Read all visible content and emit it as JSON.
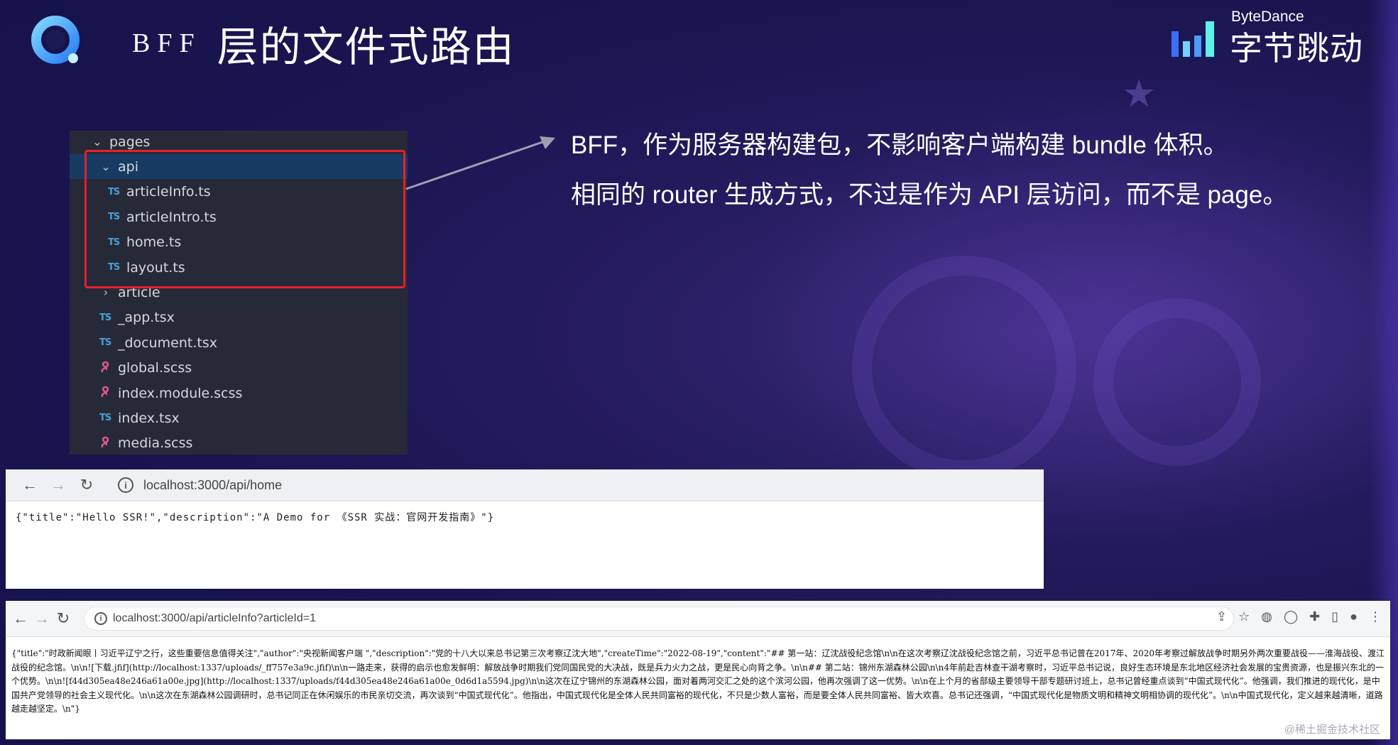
{
  "header": {
    "title_latin": "BFF",
    "title_cjk": "层的文件式路由",
    "brand_small": "ByteDance",
    "brand_main": "字节跳动"
  },
  "file_tree": {
    "rows": [
      {
        "label": "pages",
        "kind": "folder-open"
      },
      {
        "label": "api",
        "kind": "folder-open"
      },
      {
        "label": "articleInfo.ts",
        "kind": "ts"
      },
      {
        "label": "articleIntro.ts",
        "kind": "ts"
      },
      {
        "label": "home.ts",
        "kind": "ts"
      },
      {
        "label": "layout.ts",
        "kind": "ts"
      },
      {
        "label": "article",
        "kind": "folder-closed"
      },
      {
        "label": "_app.tsx",
        "kind": "ts"
      },
      {
        "label": "_document.tsx",
        "kind": "ts"
      },
      {
        "label": "global.scss",
        "kind": "scss"
      },
      {
        "label": "index.module.scss",
        "kind": "scss"
      },
      {
        "label": "index.tsx",
        "kind": "ts"
      },
      {
        "label": "media.scss",
        "kind": "scss"
      }
    ],
    "ts_badge": "TS"
  },
  "description": {
    "line1": "BFF，作为服务器构建包，不影响客户端构建 bundle 体积。",
    "line2": "相同的 router 生成方式，不过是作为 API 层访问，而不是 page。"
  },
  "browser1": {
    "url": "localhost:3000/api/home",
    "body": "{\"title\":\"Hello SSR!\",\"description\":\"A Demo for 《SSR 实战：官网开发指南》\"}"
  },
  "browser2": {
    "url": "localhost:3000/api/articleInfo?articleId=1",
    "body": "{\"title\":\"时政新闻眼丨习近平辽宁之行，这些重要信息值得关注\",\"author\":\"央视新闻客户端 \",\"description\":\"党的十八大以来总书记第三次考察辽沈大地\",\"createTime\":\"2022-08-19\",\"content\":\"## 第一站：辽沈战役纪念馆\\n\\n在这次考察辽沈战役纪念馆之前，习近平总书记曾在2017年、2020年考察过解放战争时期另外两次重要战役——淮海战役、渡江战役的纪念馆。\\n\\n![下载.jfif](http://localhost:1337/uploads/_ff757e3a9c.jfif)\\n\\n一路走来，获得的启示也愈发鲜明：解放战争时期我们党同国民党的大决战，既是兵力火力之战，更是民心向背之争。\\n\\n## 第二站：锦州东湖森林公园\\n\\n4年前赴吉林查干湖考察时，习近平总书记说，良好生态环境是东北地区经济社会发展的宝贵资源，也是振兴东北的一个优势。\\n\\n![f44d305ea48e246a61a00e.jpg](http://localhost:1337/uploads/f44d305ea48e246a61a00e_0d6d1a5594.jpg)\\n\\n这次在辽宁锦州的东湖森林公园，面对着两河交汇之处的这个滨河公园，他再次强调了这一优势。\\n\\n在上个月的省部级主要领导干部专题研讨班上，总书记曾经重点谈到“中国式现代化”。他强调，我们推进的现代化，是中国共产党领导的社会主义现代化。\\n\\n这次在东湖森林公园调研时，总书记同正在休闲娱乐的市民亲切交流，再次谈到“中国式现代化”。他指出，中国式现代化是全体人民共同富裕的现代化，不只是少数人富裕，而是要全体人民共同富裕、皆大欢喜。总书记还强调，“中国式现代化是物质文明和精神文明相协调的现代化”。\\n\\n中国式现代化，定义越来越清晰，道路越走越坚定。\\n\"}"
  },
  "watermark": "@稀土掘金技术社区",
  "colors": {
    "accent_red": "#e8202a",
    "ts_blue": "#4a9fd8",
    "scss_pink": "#e05a8a",
    "selected_row": "#183b63"
  }
}
